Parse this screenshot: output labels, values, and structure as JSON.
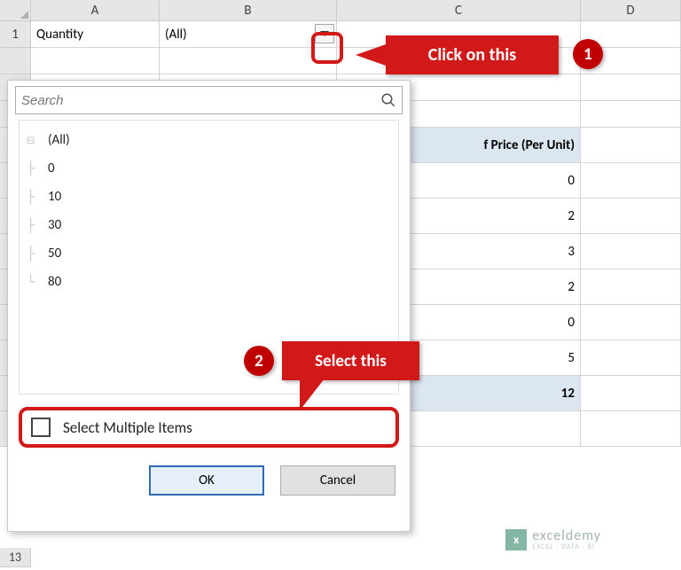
{
  "columns": {
    "A": "A",
    "B": "B",
    "C": "C",
    "D": "D"
  },
  "row_labels": {
    "r1": "1",
    "r13": "13"
  },
  "pivot_filter": {
    "field": "Quantity",
    "value": "(All)"
  },
  "pivot_header_partial": "f Price (Per Unit)",
  "pivot_values": [
    "0",
    "2",
    "3",
    "2",
    "0",
    "5"
  ],
  "pivot_total": "12",
  "popup": {
    "search_placeholder": "Search",
    "tree": [
      "(All)",
      "0",
      "10",
      "30",
      "50",
      "80"
    ],
    "multi_label": "Select Multiple Items",
    "ok": "OK",
    "cancel": "Cancel"
  },
  "callouts": {
    "c1": "Click on this",
    "c2": "Select this"
  },
  "badges": {
    "b1": "1",
    "b2": "2"
  },
  "watermark": {
    "icon": "x",
    "main": "exceldemy",
    "sub": "EXCEL · DATA · BI"
  }
}
